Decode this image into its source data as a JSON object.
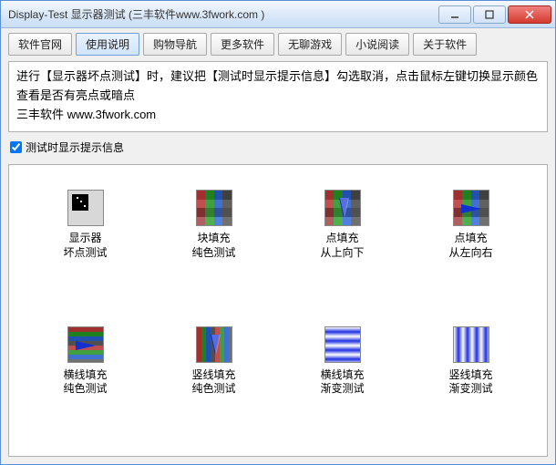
{
  "window": {
    "title": "Display-Test 显示器测试 (三丰软件www.3fwork.com )"
  },
  "tabs": [
    {
      "label": "软件官网"
    },
    {
      "label": "使用说明"
    },
    {
      "label": "购物导航"
    },
    {
      "label": "更多软件"
    },
    {
      "label": "无聊游戏"
    },
    {
      "label": "小说阅读"
    },
    {
      "label": "关于软件"
    }
  ],
  "active_tab_index": 1,
  "info": {
    "line1": "进行【显示器坏点测试】时，建议把【测试时显示提示信息】勾选取消，点击鼠标左键切换显示颜色查看是否有亮点或暗点",
    "line2": "三丰软件  www.3fwork.com"
  },
  "checkbox": {
    "label": "测试时显示提示信息",
    "checked": true
  },
  "tests": [
    {
      "id": "deadpixel",
      "label": "显示器\n坏点测试",
      "icon": "deadpixel-icon"
    },
    {
      "id": "block-solid",
      "label": "块填充\n纯色测试",
      "icon": "block-solid-icon"
    },
    {
      "id": "point-topdown",
      "label": "点填充\n从上向下",
      "icon": "point-topdown-icon"
    },
    {
      "id": "point-leftright",
      "label": "点填充\n从左向右",
      "icon": "point-leftright-icon"
    },
    {
      "id": "hline-solid",
      "label": "横线填充\n纯色测试",
      "icon": "hline-solid-icon"
    },
    {
      "id": "vline-solid",
      "label": "竖线填充\n纯色测试",
      "icon": "vline-solid-icon"
    },
    {
      "id": "hline-gradient",
      "label": "横线填充\n渐变测试",
      "icon": "hline-gradient-icon"
    },
    {
      "id": "vline-gradient",
      "label": "竖线填充\n渐变测试",
      "icon": "vline-gradient-icon"
    }
  ]
}
